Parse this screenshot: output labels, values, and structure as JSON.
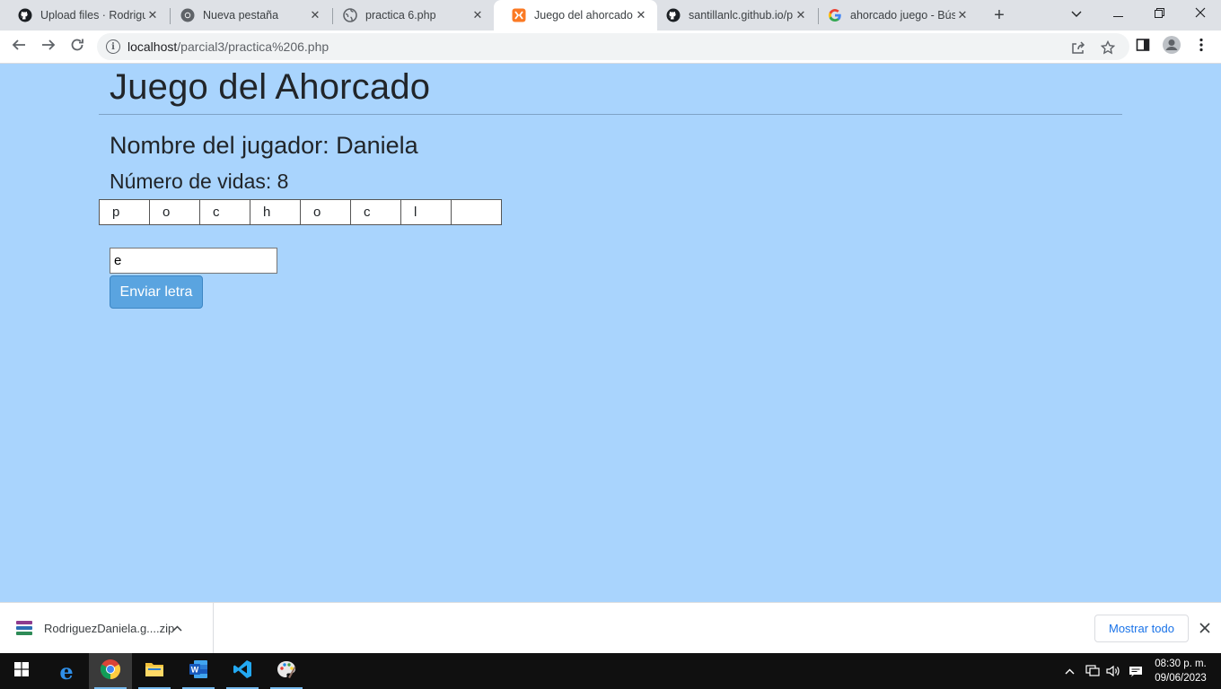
{
  "browser": {
    "tabs": [
      {
        "title": "Upload files · Rodrigue",
        "icon": "github-icon",
        "active": false
      },
      {
        "title": "Nueva pestaña",
        "icon": "chrome-icon",
        "active": false
      },
      {
        "title": "practica 6.php",
        "icon": "globe-icon",
        "active": false
      },
      {
        "title": "Juego del ahorcado",
        "icon": "xampp-icon",
        "active": true
      },
      {
        "title": "santillanlc.github.io/p",
        "icon": "github-icon",
        "active": false
      },
      {
        "title": "ahorcado juego - Búsq",
        "icon": "google-icon",
        "active": false
      }
    ],
    "url_host": "localhost",
    "url_path": "/parcial3/practica%206.php"
  },
  "page": {
    "title": "Juego del Ahorcado",
    "player_line": "Nombre del jugador: Daniela",
    "lives_line": "Número de vidas: 8",
    "letters": [
      "p",
      "o",
      "c",
      "h",
      "o",
      "c",
      "l",
      ""
    ],
    "input_value": "e",
    "submit_label": "Enviar letra",
    "background_color": "#a9d4fd"
  },
  "downloads": {
    "file_name": "RodriguezDaniela.g....zip",
    "show_all_label": "Mostrar todo"
  },
  "taskbar": {
    "time": "08:30 p. m.",
    "date": "09/06/2023"
  }
}
